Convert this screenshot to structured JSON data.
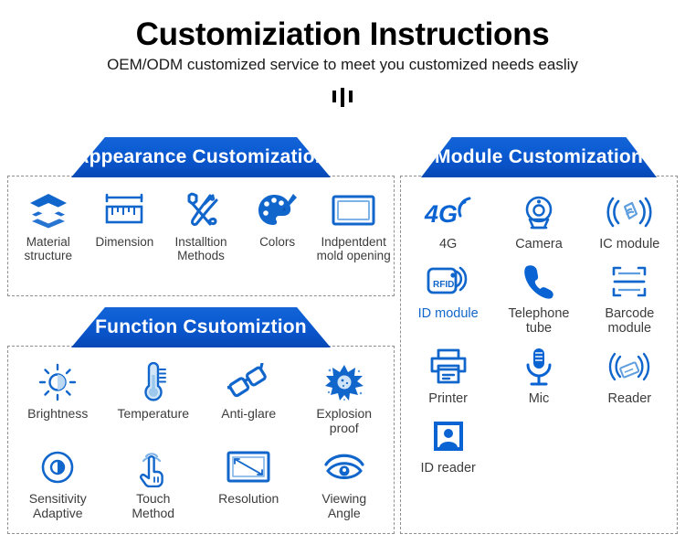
{
  "header": {
    "title": "Customiziation Instructions",
    "subtitle": "OEM/ODM customized service to meet you customized needs easliy"
  },
  "colors": {
    "banner_top": "#1565d8",
    "banner_bottom": "#0748b5",
    "icon_blue": "#1166cc",
    "icon_blue_deep": "#0a52c6",
    "caption_gray": "#3c3c3c",
    "dash_border": "#8f8f8f"
  },
  "panels": {
    "appearance": {
      "title": "Appearance Customization",
      "items": [
        {
          "label": "Material\nstructure",
          "icon": "layers-icon"
        },
        {
          "label": "Dimension",
          "icon": "ruler-icon"
        },
        {
          "label": "Installtion\nMethods",
          "icon": "tools-icon"
        },
        {
          "label": "Colors",
          "icon": "palette-icon"
        },
        {
          "label": "Indpentdent\nmold opening",
          "icon": "screen-frame-icon"
        }
      ]
    },
    "function": {
      "title": "Function Csutomiztion",
      "items": [
        {
          "label": "Brightness",
          "icon": "sun-brightness-icon"
        },
        {
          "label": "Temperature",
          "icon": "thermometer-icon"
        },
        {
          "label": "Anti-glare",
          "icon": "glasses-icon"
        },
        {
          "label": "Explosion\nproof",
          "icon": "explosion-burst-icon"
        },
        {
          "label": "Sensitivity\nAdaptive",
          "icon": "sensor-circle-icon"
        },
        {
          "label": "Touch\nMethod",
          "icon": "touch-hand-icon"
        },
        {
          "label": "Resolution",
          "icon": "screen-diagonal-icon"
        },
        {
          "label": "Viewing\nAngle",
          "icon": "eye-icon"
        }
      ]
    },
    "module": {
      "title": "Module Customization",
      "items": [
        {
          "label": "4G",
          "icon": "4g-signal-icon",
          "label_color": "gray"
        },
        {
          "label": "Camera",
          "icon": "camera-icon",
          "label_color": "gray"
        },
        {
          "label": "IC module",
          "icon": "ic-nfc-icon",
          "label_color": "gray"
        },
        {
          "label": "ID module",
          "icon": "rfid-card-icon",
          "label_color": "blue"
        },
        {
          "label": "Telephone\ntube",
          "icon": "telephone-handset-icon",
          "label_color": "gray"
        },
        {
          "label": "Barcode\nmodule",
          "icon": "barcode-scan-icon",
          "label_color": "gray"
        },
        {
          "label": "Printer",
          "icon": "printer-icon",
          "label_color": "gray"
        },
        {
          "label": "Mic",
          "icon": "microphone-icon",
          "label_color": "gray"
        },
        {
          "label": "Reader",
          "icon": "card-reader-wave-icon",
          "label_color": "gray"
        },
        {
          "label": "ID reader",
          "icon": "id-photo-icon",
          "label_color": "gray"
        }
      ]
    }
  }
}
